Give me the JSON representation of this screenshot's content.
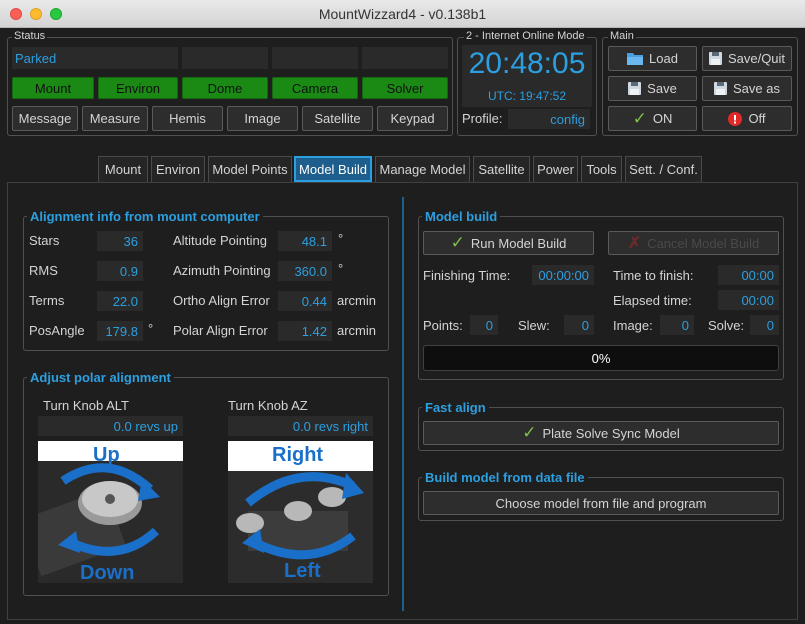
{
  "window": {
    "title": "MountWizzard4 - v0.138b1"
  },
  "status": {
    "group_label": "Status",
    "mount_status": "Parked",
    "indicators": [
      "Mount",
      "Environ",
      "Dome",
      "Camera",
      "Solver"
    ],
    "buttons": [
      "Message",
      "Measure",
      "Hemis",
      "Image",
      "Satellite",
      "Keypad"
    ]
  },
  "online": {
    "group_label": "2 - Internet Online Mode",
    "time": "20:48:05",
    "utc": "UTC: 19:47:52",
    "profile_label": "Profile:",
    "profile_value": "config"
  },
  "main": {
    "group_label": "Main",
    "load": "Load",
    "save_quit": "Save/Quit",
    "save": "Save",
    "save_as": "Save as",
    "on": "ON",
    "off": "Off"
  },
  "tabs": [
    "Mount",
    "Environ",
    "Model Points",
    "Model Build",
    "Manage Model",
    "Satellite",
    "Power",
    "Tools",
    "Sett. / Conf."
  ],
  "active_tab": "Model Build",
  "alignment": {
    "title": "Alignment info from mount computer",
    "stars_label": "Stars",
    "stars": "36",
    "rms_label": "RMS",
    "rms": "0.9",
    "terms_label": "Terms",
    "terms": "22.0",
    "posangle_label": "PosAngle",
    "posangle": "179.8",
    "posangle_unit": "°",
    "alt_label": "Altitude Pointing",
    "alt": "48.1",
    "alt_unit": "°",
    "az_label": "Azimuth Pointing",
    "az": "360.0",
    "az_unit": "°",
    "ortho_label": "Ortho Align Error",
    "ortho": "0.44",
    "ortho_unit": "arcmin",
    "polar_label": "Polar Align Error",
    "polar": "1.42",
    "polar_unit": "arcmin"
  },
  "polar": {
    "title": "Adjust polar alignment",
    "alt_label": "Turn Knob ALT",
    "alt_value": "0.0 revs up",
    "az_label": "Turn Knob AZ",
    "az_value": "0.0 revs right",
    "alt_up": "Up",
    "alt_down": "Down",
    "az_right": "Right",
    "az_left": "Left"
  },
  "model_build": {
    "title": "Model build",
    "run": "Run Model Build",
    "cancel": "Cancel Model Build",
    "finishing_label": "Finishing Time:",
    "finishing": "00:00:00",
    "to_finish_label": "Time to finish:",
    "to_finish": "00:00",
    "elapsed_label": "Elapsed time:",
    "elapsed": "00:00",
    "points_label": "Points:",
    "points": "0",
    "slew_label": "Slew:",
    "slew": "0",
    "image_label": "Image:",
    "image": "0",
    "solve_label": "Solve:",
    "solve": "0",
    "progress": "0%",
    "progress_value": 0
  },
  "fast_align": {
    "title": "Fast align",
    "button": "Plate Solve  Sync Model"
  },
  "build_file": {
    "title": "Build model from data file",
    "button": "Choose model from file and program"
  },
  "colors": {
    "accent": "#2c9fe0",
    "green": "#1a8a14",
    "background": "#1e1e1e"
  }
}
